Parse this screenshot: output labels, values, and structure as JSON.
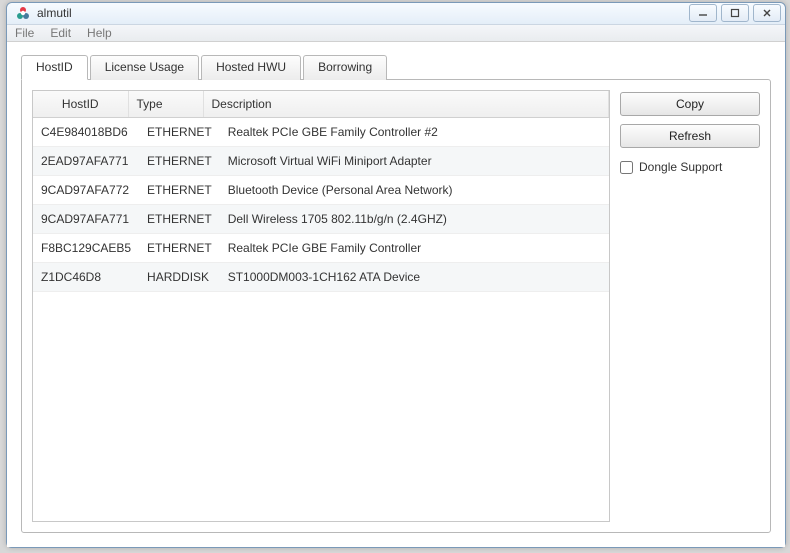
{
  "window": {
    "title": "almutil"
  },
  "menu": {
    "file": "File",
    "edit": "Edit",
    "help": "Help"
  },
  "tabs": [
    {
      "label": "HostID"
    },
    {
      "label": "License Usage"
    },
    {
      "label": "Hosted HWU"
    },
    {
      "label": "Borrowing"
    }
  ],
  "columns": {
    "hostid": "HostID",
    "type": "Type",
    "description": "Description"
  },
  "rows": [
    {
      "hostid": "C4E984018BD6",
      "type": "ETHERNET",
      "desc": "Realtek PCIe GBE Family Controller #2"
    },
    {
      "hostid": "2EAD97AFA771",
      "type": "ETHERNET",
      "desc": "Microsoft Virtual WiFi Miniport Adapter"
    },
    {
      "hostid": "9CAD97AFA772",
      "type": "ETHERNET",
      "desc": "Bluetooth Device (Personal Area Network)"
    },
    {
      "hostid": "9CAD97AFA771",
      "type": "ETHERNET",
      "desc": "Dell Wireless 1705 802.11b/g/n (2.4GHZ)"
    },
    {
      "hostid": "F8BC129CAEB5",
      "type": "ETHERNET",
      "desc": "Realtek PCIe GBE Family Controller"
    },
    {
      "hostid": "Z1DC46D8",
      "type": "HARDDISK",
      "desc": "ST1000DM003-1CH162 ATA Device"
    }
  ],
  "buttons": {
    "copy": "Copy",
    "refresh": "Refresh"
  },
  "checkbox": {
    "dongle": "Dongle Support"
  }
}
